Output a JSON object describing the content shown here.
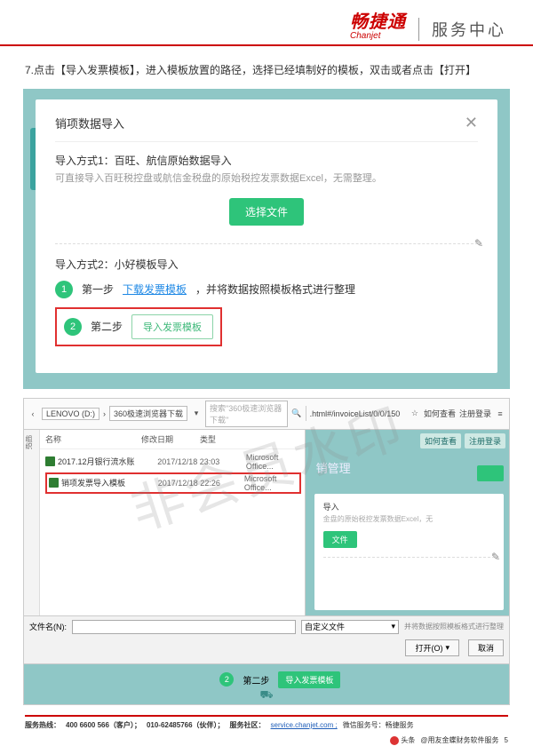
{
  "brand": {
    "cn": "畅捷通",
    "en": "Chanjet",
    "svc": "服务中心"
  },
  "instruction": "7.点击【导入发票模板】，进入模板放置的路径，选择已经填制好的模板，双击或者点击【打开】",
  "dialog": {
    "title": "销项数据导入",
    "m1_title": "导入方式1：百旺、航信原始数据导入",
    "m1_desc": "可直接导入百旺税控盘或航信金税盘的原始税控发票数据Excel，无需整理。",
    "select_file_btn": "选择文件",
    "m2_title": "导入方式2：小好模板导入",
    "step1_label": "第一步",
    "step1_link": "下载发票模板",
    "step1_suffix": "，并将数据按照模板格式进行整理",
    "step2_label": "第二步",
    "step2_btn": "导入发票模板"
  },
  "filepicker": {
    "path_drive": "LENOVO (D:)",
    "path_folder": "360极速浏览器下载",
    "search_ph": "搜索\"360极速浏览器下载\"",
    "url": ".html#/invoiceList/0/0/150",
    "tab1": "如何查看",
    "tab2": "注册登录",
    "col_name": "名称",
    "col_date": "修改日期",
    "col_type": "类型",
    "rows": [
      {
        "name": "2017.12月银行流水账",
        "date": "2017/12/18 23:03",
        "type": "Microsoft Office..."
      },
      {
        "name": "销项发票导入模板",
        "date": "2017/12/18 22:26",
        "type": "Microsoft Office..."
      }
    ],
    "side_label": "组织",
    "filename_label": "文件名(N):",
    "filter": "自定义文件",
    "open_btn": "打开(O)",
    "cancel_btn": "取消",
    "right_title": "销管理",
    "right_m1": "导入",
    "right_m1_desc": "金盘的原始税控发票数据Excel，无",
    "right_btn": "文件",
    "note_text": "并将数据按照模板格式进行整理",
    "mini_step2": "第二步",
    "mini_btn": "导入发票模板"
  },
  "watermark": "非会员水印",
  "footer": {
    "hotline_label": "服务热线：",
    "hotline_cust": "400 6600 566（客户）；",
    "hotline_partner": "010-62485766（伙伴）；",
    "community_label": "服务社区：",
    "community_link": "service.chanjet.com ;",
    "wechat_label": "微信服务号：畅捷服务",
    "toutiao_prefix": "头条",
    "toutiao_handle": "@用友金蝶财务软件服务",
    "page": "5"
  }
}
